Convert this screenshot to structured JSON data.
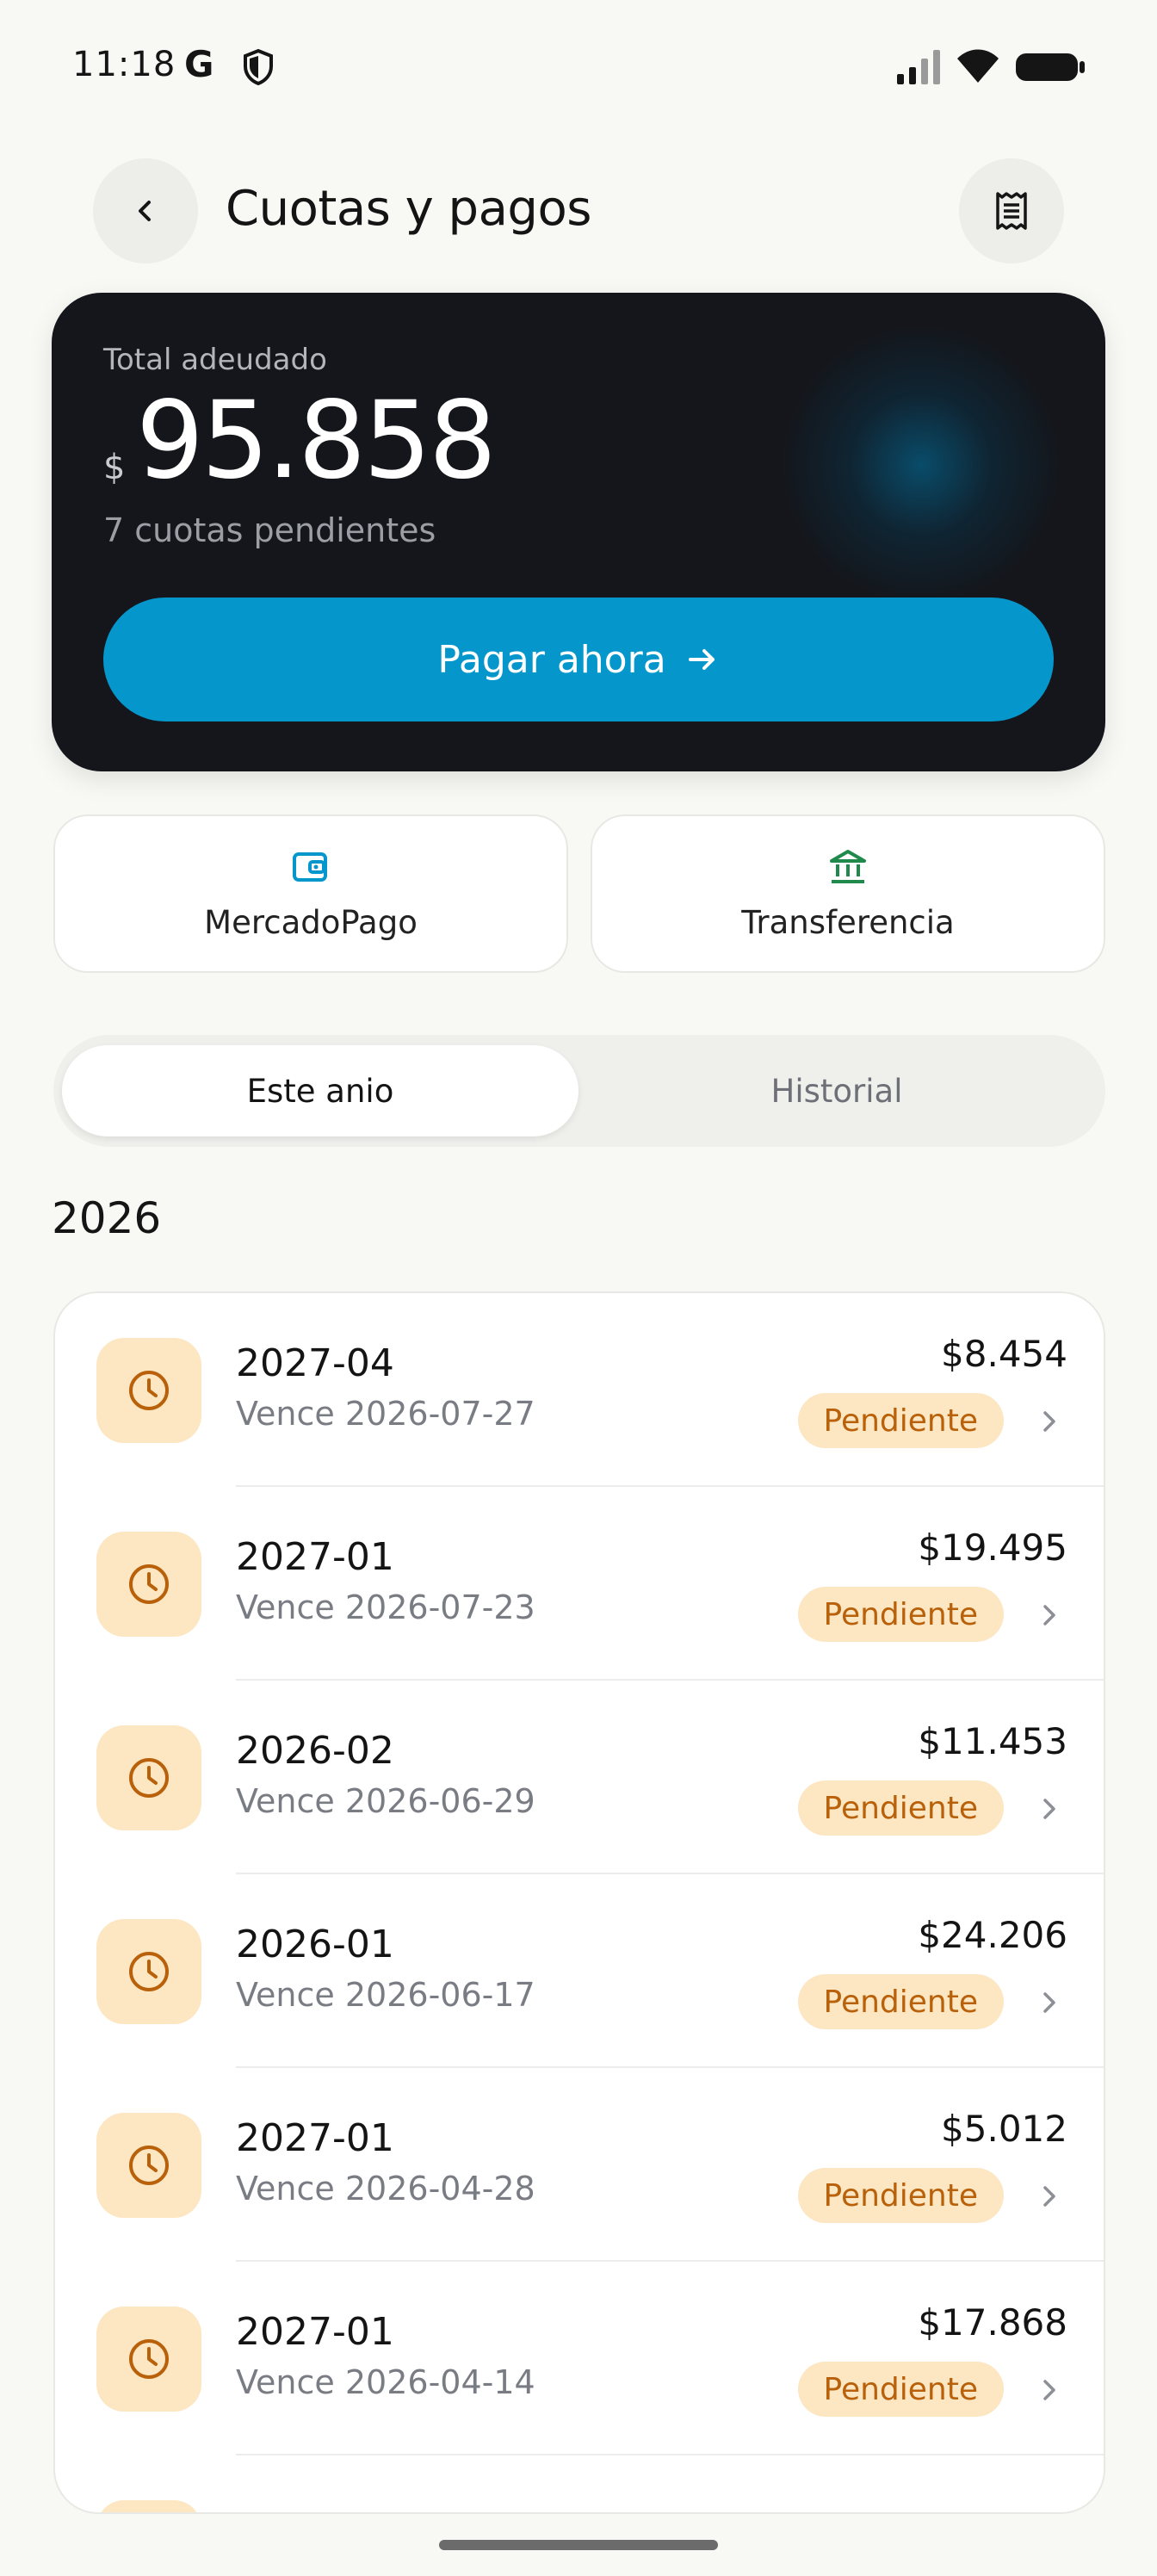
{
  "status_bar": {
    "time": "11:18",
    "g_letter": "G",
    "icons": [
      "shield-icon",
      "signal-icon",
      "wifi-icon",
      "battery-icon"
    ]
  },
  "header": {
    "title": "Cuotas y pagos",
    "back_icon": "chevron-left-icon",
    "action_icon": "receipt-icon"
  },
  "summary": {
    "label": "Total adeudado",
    "currency": "$",
    "amount": "95.858",
    "subtitle": "7 cuotas pendientes",
    "pay_button_label": "Pagar ahora",
    "pay_button_icon": "arrow-right-icon"
  },
  "payment_methods": [
    {
      "label": "MercadoPago",
      "icon": "wallet-icon",
      "color": "#0596cb"
    },
    {
      "label": "Transferencia",
      "icon": "bank-icon",
      "color": "#1f8a4c"
    }
  ],
  "tabs": [
    {
      "label": "Este anio",
      "active": true
    },
    {
      "label": "Historial",
      "active": false
    }
  ],
  "year": "2026",
  "installments": [
    {
      "title": "2027-04",
      "due": "Vence 2026-07-27",
      "amount": "$8.454",
      "status": "Pendiente"
    },
    {
      "title": "2027-01",
      "due": "Vence 2026-07-23",
      "amount": "$19.495",
      "status": "Pendiente"
    },
    {
      "title": "2026-02",
      "due": "Vence 2026-06-29",
      "amount": "$11.453",
      "status": "Pendiente"
    },
    {
      "title": "2026-01",
      "due": "Vence 2026-06-17",
      "amount": "$24.206",
      "status": "Pendiente"
    },
    {
      "title": "2027-01",
      "due": "Vence 2026-04-28",
      "amount": "$5.012",
      "status": "Pendiente"
    },
    {
      "title": "2027-01",
      "due": "Vence 2026-04-14",
      "amount": "$17.868",
      "status": "Pendiente"
    }
  ],
  "colors": {
    "accent": "#0596cb",
    "pending_bg": "#fde6c2",
    "pending_text": "#b8610a",
    "card_dark": "#14161b"
  }
}
